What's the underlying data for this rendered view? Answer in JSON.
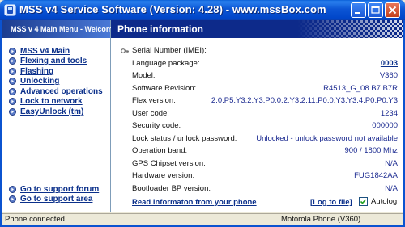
{
  "window": {
    "title": "MSS v4 Service Software (Version: 4.28) - www.mssBox.com"
  },
  "left_menu": {
    "header": "MSS v 4 Main Menu - Welcome",
    "items": [
      {
        "label": "MSS v4 Main"
      },
      {
        "label": "Flexing and tools"
      },
      {
        "label": "Flashing"
      },
      {
        "label": "Unlocking"
      },
      {
        "label": "Advanced operations"
      },
      {
        "label": "Lock to network"
      },
      {
        "label": "EasyUnlock (tm)"
      }
    ],
    "support": [
      {
        "label": "Go to support forum"
      },
      {
        "label": "Go to support area"
      }
    ]
  },
  "panel": {
    "title": "Phone information",
    "rows": [
      {
        "label": "Serial Number (IMEI):",
        "value": ""
      },
      {
        "label": "Language package:",
        "value": "0003"
      },
      {
        "label": "Model:",
        "value": "V360"
      },
      {
        "label": "Software Revision:",
        "value": "R4513_G_08.B7.B7R"
      },
      {
        "label": "Flex version:",
        "value": "2.0.P5.Y3.2.Y3.P0.0.2.Y3.2.11.P0.0.Y3.Y3.4.P0.P0.Y3"
      },
      {
        "label": "User code:",
        "value": "1234"
      },
      {
        "label": "Security code:",
        "value": "000000"
      },
      {
        "label": "Lock status / unlock password:",
        "value": "Unlocked - unlock password not available"
      },
      {
        "label": "Operation band:",
        "value": "900 / 1800 Mhz"
      },
      {
        "label": "GPS Chipset version:",
        "value": "N/A"
      },
      {
        "label": "Hardware version:",
        "value": "FUG1842AA"
      },
      {
        "label": "Bootloader BP version:",
        "value": "N/A"
      }
    ],
    "read_link": "Read informaton from your phone",
    "log_link": "[Log to file]",
    "autolog_label": "Autolog",
    "autolog_checked": true
  },
  "status": {
    "left": "Phone connected",
    "right": "Motorola Phone (V360)"
  },
  "colors": {
    "titlebar": "#0b55d4",
    "panel_header": "#0d2a8a",
    "link": "#0a2f8a"
  }
}
